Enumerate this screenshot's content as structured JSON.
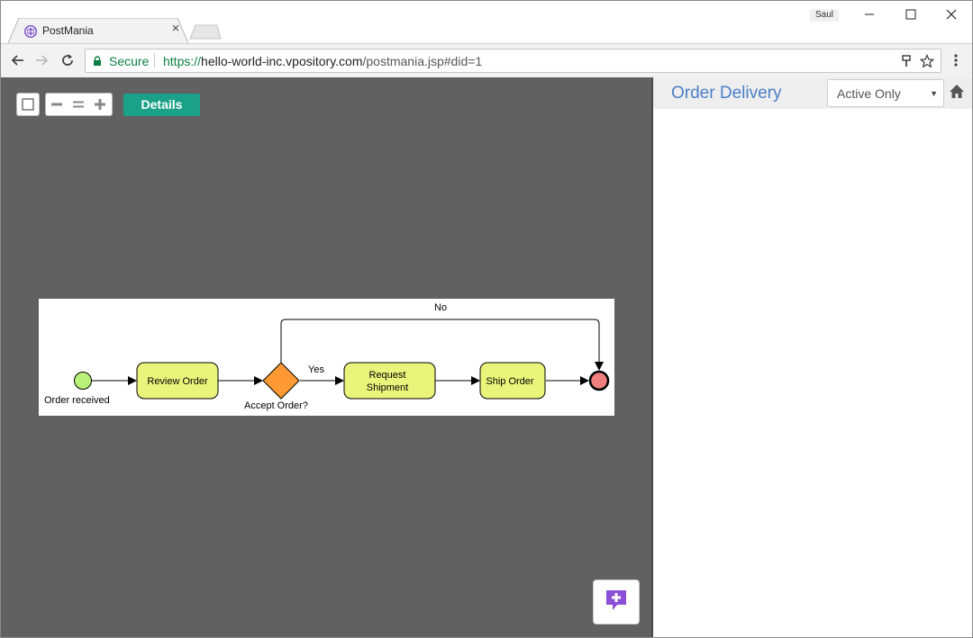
{
  "browser": {
    "tab": {
      "title": "PostMania",
      "favicon": "globe-icon",
      "close": "×"
    },
    "user": "Saul",
    "window_controls": [
      "minimize-icon",
      "maximize-icon",
      "close-icon"
    ],
    "address": {
      "security_label": "Secure",
      "url_scheme": "https://",
      "url_host": "hello-world-inc.vpository.com",
      "url_path": "/postmania.jsp#did=1"
    },
    "icons": {
      "back": "back-arrow-icon",
      "forward": "forward-arrow-icon",
      "reload": "reload-icon",
      "key": "key-icon",
      "star": "bookmark-star-icon",
      "menu": "kebab-menu-icon"
    }
  },
  "canvas": {
    "zoom_controls": [
      "zoom-fit-icon",
      "zoom-out-icon",
      "zoom-reset-icon",
      "zoom-in-icon"
    ],
    "details_label": "Details",
    "background": "#616161",
    "diagram": {
      "start_label": "Order received",
      "task_review": "Review Order",
      "gateway_label": "Accept Order?",
      "task_request_line1": "Request",
      "task_request_line2": "Shipment",
      "task_ship": "Ship Order",
      "flow_yes": "Yes",
      "flow_no": "No",
      "colors": {
        "task": "#e8f57a",
        "start": "#b8f07a",
        "gateway": "#ff9933",
        "end": "#f08080"
      }
    },
    "chat_button": "add-comment-icon"
  },
  "panel": {
    "title": "Order Delivery",
    "filter": {
      "selected": "Active Only"
    },
    "home": "home-icon",
    "title_color": "#4a7fc9"
  }
}
